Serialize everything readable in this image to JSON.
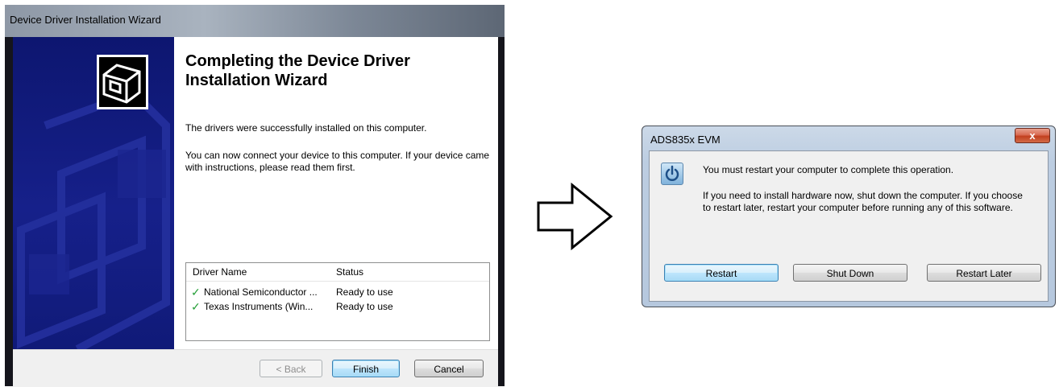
{
  "wizard": {
    "title": "Device Driver Installation Wizard",
    "heading": "Completing the Device Driver Installation Wizard",
    "message1": "The drivers were successfully installed on this computer.",
    "message2": "You can now connect your device to this computer. If your device came with instructions, please read them first.",
    "driver_list": {
      "columns": [
        "Driver Name",
        "Status"
      ],
      "rows": [
        {
          "name": "National Semiconductor ...",
          "status": "Ready to use"
        },
        {
          "name": "Texas Instruments (Win...",
          "status": "Ready to use"
        }
      ]
    },
    "buttons": {
      "back": "< Back",
      "finish": "Finish",
      "cancel": "Cancel"
    }
  },
  "dialog": {
    "title": "ADS835x EVM",
    "close_label": "x",
    "message1": "You must restart your computer to complete this operation.",
    "message2": "If you need to install hardware now, shut down the computer. If you choose to restart later, restart your computer before running any of this software.",
    "buttons": {
      "restart": "Restart",
      "shut_down": "Shut Down",
      "restart_later": "Restart Later"
    }
  },
  "icons": {
    "wizard_logo": "hardware-box-icon",
    "check": "check-icon",
    "dialog": "power-icon",
    "arrow": "right-arrow-icon"
  }
}
